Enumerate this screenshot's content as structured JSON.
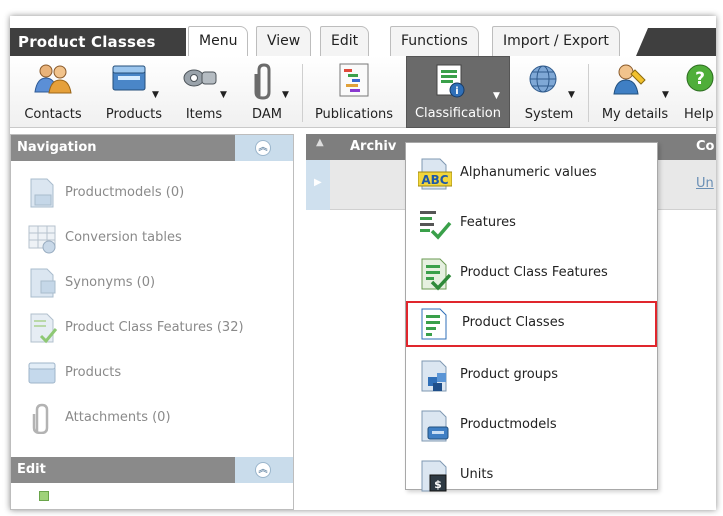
{
  "app": {
    "title": "Product Classes"
  },
  "tabs": [
    {
      "label": "Menu",
      "active": true
    },
    {
      "label": "View"
    },
    {
      "label": "Edit"
    },
    {
      "label": "Functions"
    },
    {
      "label": "Import / Export"
    }
  ],
  "toolbar": [
    {
      "label": "Contacts",
      "icon": "contacts-icon"
    },
    {
      "label": "Products",
      "icon": "products-icon"
    },
    {
      "label": "Items",
      "icon": "items-icon"
    },
    {
      "label": "DAM",
      "icon": "paperclip-icon"
    },
    {
      "label": "Publications",
      "icon": "publications-icon"
    },
    {
      "label": "Classification",
      "icon": "classification-icon",
      "active": true
    },
    {
      "label": "System",
      "icon": "globe-icon"
    },
    {
      "label": "My details",
      "icon": "user-edit-icon"
    },
    {
      "label": "Help",
      "icon": "help-icon"
    }
  ],
  "navigation": {
    "header": "Navigation",
    "items": [
      {
        "label": "Productmodels (0)",
        "icon": "productmodels-icon"
      },
      {
        "label": "Conversion tables",
        "icon": "conversion-table-icon"
      },
      {
        "label": "Synonyms (0)",
        "icon": "synonyms-icon"
      },
      {
        "label": "Product Class Features (32)",
        "icon": "product-class-features-icon"
      },
      {
        "label": "Products",
        "icon": "products-icon"
      },
      {
        "label": "Attachments (0)",
        "icon": "paperclip-icon"
      }
    ]
  },
  "edit_panel": {
    "header": "Edit"
  },
  "grid": {
    "columns": [
      "Archiv",
      "Co"
    ],
    "rows": [
      {
        "link": "Un"
      }
    ]
  },
  "classification_menu": {
    "items": [
      {
        "label": "Alphanumeric values",
        "icon": "abc-icon"
      },
      {
        "label": "Features",
        "icon": "features-icon"
      },
      {
        "label": "Product Class Features",
        "icon": "product-class-features-icon"
      },
      {
        "label": "Product Classes",
        "icon": "product-classes-icon",
        "highlighted": true
      },
      {
        "label": "Product groups",
        "icon": "product-groups-icon"
      },
      {
        "label": "Productmodels",
        "icon": "productmodels-icon"
      },
      {
        "label": "Units",
        "icon": "units-icon"
      }
    ]
  },
  "colors": {
    "dark_bar": "#3f3f3f",
    "active_toolbar": "#6a6a6a",
    "panel_header": "#8a8a8a",
    "collapse_bg": "#c9dceb",
    "highlight_border": "#e0262d",
    "link": "#6a8fb5"
  }
}
